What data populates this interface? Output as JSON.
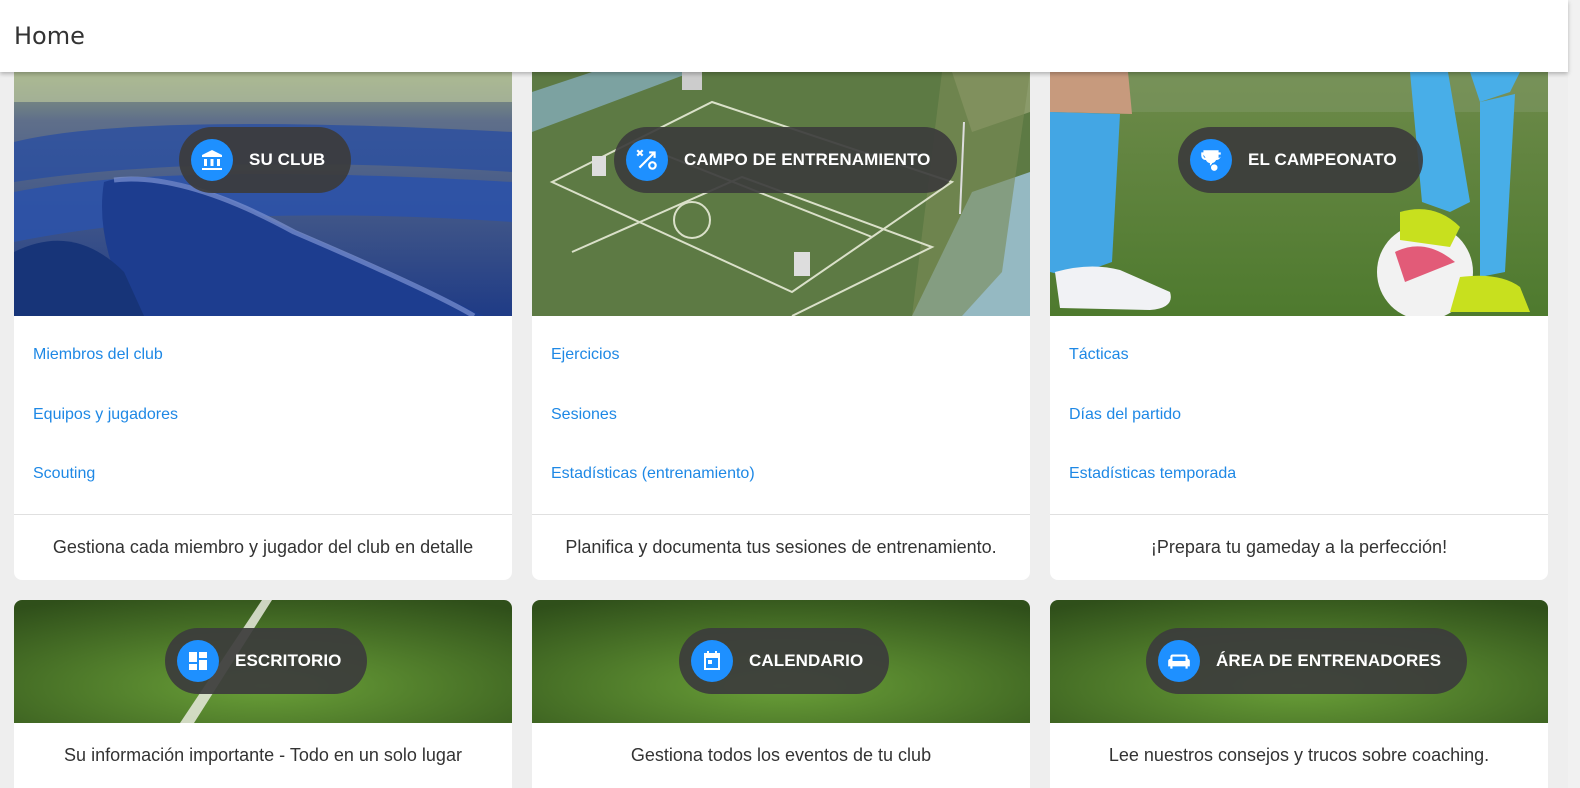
{
  "header": {
    "title": "Home"
  },
  "cards": [
    {
      "title": "SU CLUB",
      "icon": "bank-icon",
      "links": [
        "Miembros del club",
        "Equipos y jugadores",
        "Scouting"
      ],
      "description": "Gestiona cada miembro y jugador del club en detalle"
    },
    {
      "title": "CAMPO DE ENTRENAMIENTO",
      "icon": "tactics-icon",
      "links": [
        "Ejercicios",
        "Sesiones",
        "Estadísticas (entrenamiento)"
      ],
      "description": "Planifica y documenta tus sesiones de entrenamiento."
    },
    {
      "title": "EL CAMPEONATO",
      "icon": "trophy-icon",
      "links": [
        "Tácticas",
        "Días del partido",
        "Estadísticas temporada"
      ],
      "description": "¡Prepara tu gameday a la perfección!"
    },
    {
      "title": "ESCRITORIO",
      "icon": "dashboard-icon",
      "description": "Su información importante - Todo en un solo lugar"
    },
    {
      "title": "CALENDARIO",
      "icon": "calendar-icon",
      "description": "Gestiona todos los eventos de tu club"
    },
    {
      "title": "ÁREA DE ENTRENADORES",
      "icon": "sofa-icon",
      "description": "Lee nuestros consejos y trucos sobre coaching."
    }
  ],
  "colors": {
    "accent": "#1e90ff",
    "link": "#1e88e5",
    "pill": "#3c3c3c"
  }
}
